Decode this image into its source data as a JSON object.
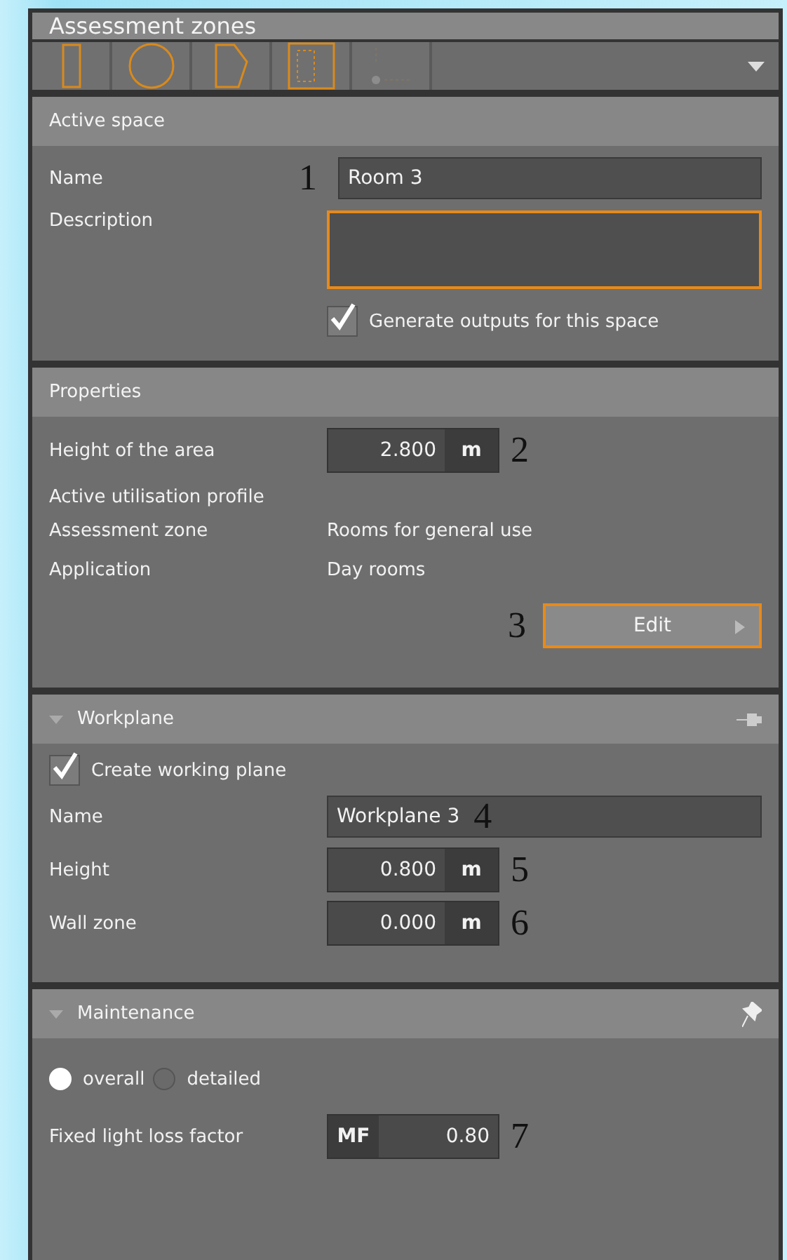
{
  "panel": {
    "title": "Assessment zones"
  },
  "toolbar": {
    "tools": [
      {
        "kind": "rectangle",
        "disabled": false
      },
      {
        "kind": "circle",
        "disabled": false
      },
      {
        "kind": "polygon",
        "disabled": false
      },
      {
        "kind": "room",
        "disabled": false
      },
      {
        "kind": "point",
        "disabled": true
      }
    ]
  },
  "active_space": {
    "title": "Active space",
    "fields": [
      {
        "kind": "text",
        "label": "Name",
        "value": "Room 3",
        "marker": "1",
        "focused": false
      },
      {
        "kind": "area",
        "label": "Description",
        "focused": true
      }
    ],
    "generate_outputs": {
      "label": "Generate outputs for this space",
      "checked": true
    }
  },
  "properties": {
    "title": "Properties",
    "height": {
      "label": "Height of the area",
      "value": "2.800",
      "unit": "m",
      "marker": "2"
    },
    "profile_title": "Active utilisation profile",
    "rows": [
      {
        "label": "Assessment zone",
        "value": "Rooms for general use"
      },
      {
        "label": "Application",
        "value": "Day rooms"
      }
    ],
    "edit": {
      "label": "Edit",
      "marker": "3"
    }
  },
  "workplane": {
    "title": "Workplane",
    "create": {
      "label": "Create working plane",
      "checked": true
    },
    "fields": [
      {
        "kind": "text",
        "label": "Name",
        "value": "Workplane 3",
        "marker": "4"
      },
      {
        "kind": "number",
        "label": "Height",
        "value": "0.800",
        "unit": "m",
        "marker": "5"
      },
      {
        "kind": "number",
        "label": "Wall zone",
        "value": "0.000",
        "unit": "m",
        "marker": "6"
      }
    ]
  },
  "maintenance": {
    "title": "Maintenance",
    "modes": [
      {
        "label": "overall",
        "selected": true
      },
      {
        "label": "detailed",
        "selected": false
      }
    ],
    "factor": {
      "label": "Fixed light loss factor",
      "prefix": "MF",
      "value": "0.80",
      "marker": "7"
    }
  }
}
